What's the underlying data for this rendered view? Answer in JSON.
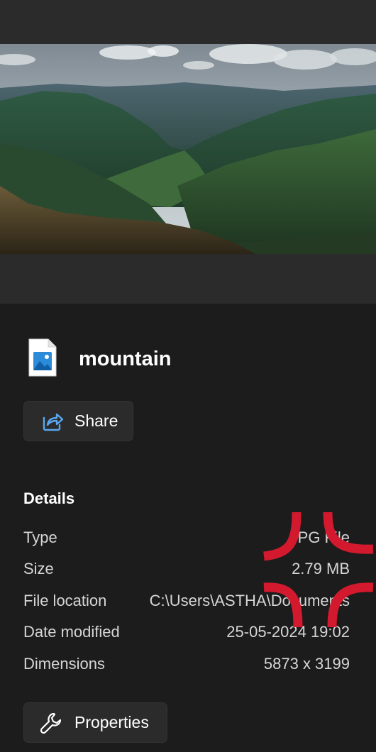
{
  "file": {
    "name": "mountain"
  },
  "actions": {
    "share_label": "Share",
    "properties_label": "Properties"
  },
  "details": {
    "heading": "Details",
    "rows": [
      {
        "label": "Type",
        "value": "JPG File"
      },
      {
        "label": "Size",
        "value": "2.79 MB"
      },
      {
        "label": "File location",
        "value": "C:\\Users\\ASTHA\\Documents"
      },
      {
        "label": "Date modified",
        "value": "25-05-2024 19:02"
      },
      {
        "label": "Dimensions",
        "value": "5873 x 3199"
      }
    ]
  },
  "icons": {
    "file": "image-file-icon",
    "share": "share-icon",
    "properties": "wrench-icon"
  },
  "colors": {
    "background": "#1c1c1c",
    "preview_background": "#2b2b2b",
    "button_background": "#2b2b2b",
    "annotation_red": "#d3192e"
  }
}
